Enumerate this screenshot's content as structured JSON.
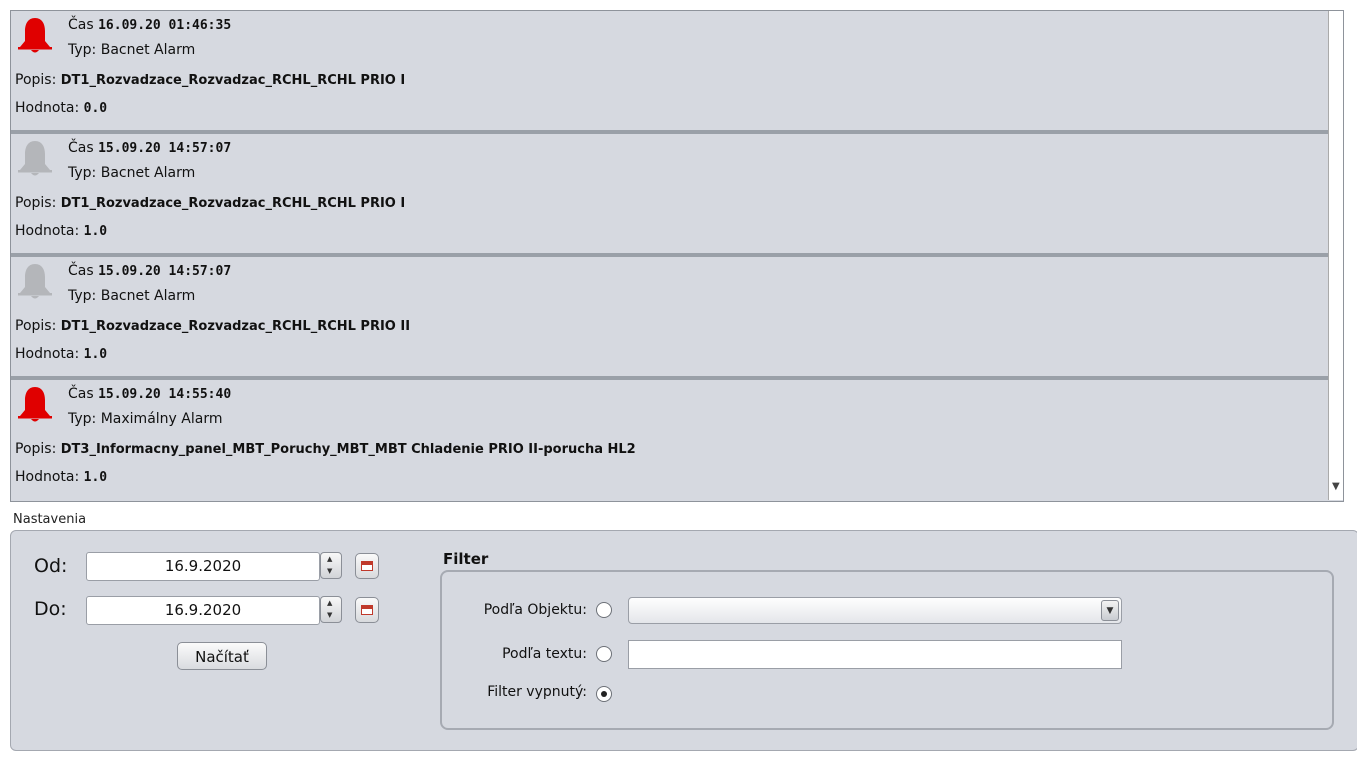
{
  "alarms": [
    {
      "active": true,
      "time_label": "Čas",
      "time": "16.09.20 01:46:35",
      "type_label": "Typ:",
      "type": "Bacnet Alarm",
      "desc_label": "Popis:",
      "desc": "DT1_Rozvadzace_Rozvadzac_RCHL_RCHL PRIO I",
      "value_label": "Hodnota:",
      "value": "0.0"
    },
    {
      "active": false,
      "time_label": "Čas",
      "time": "15.09.20 14:57:07",
      "type_label": "Typ:",
      "type": "Bacnet Alarm",
      "desc_label": "Popis:",
      "desc": "DT1_Rozvadzace_Rozvadzac_RCHL_RCHL PRIO I",
      "value_label": "Hodnota:",
      "value": "1.0"
    },
    {
      "active": false,
      "time_label": "Čas",
      "time": "15.09.20 14:57:07",
      "type_label": "Typ:",
      "type": "Bacnet Alarm",
      "desc_label": "Popis:",
      "desc": "DT1_Rozvadzace_Rozvadzac_RCHL_RCHL PRIO II",
      "value_label": "Hodnota:",
      "value": "1.0"
    },
    {
      "active": true,
      "time_label": "Čas",
      "time": "15.09.20 14:55:40",
      "type_label": "Typ:",
      "type": "Maximálny Alarm",
      "desc_label": "Popis:",
      "desc": "DT3_Informacny_panel_MBT_Poruchy_MBT_MBT Chladenie PRIO II-porucha HL2",
      "value_label": "Hodnota:",
      "value": "1.0"
    }
  ],
  "colors": {
    "bell_active": "#e00000",
    "bell_inactive": "#b4b6ba"
  },
  "settings": {
    "title": "Nastavenia",
    "from_label": "Od:",
    "from_value": "16.9.2020",
    "to_label": "Do:",
    "to_value": "16.9.2020",
    "load_button": "Načítať"
  },
  "filter": {
    "title": "Filter",
    "by_object_label": "Podľa Objektu:",
    "by_text_label": "Podľa textu:",
    "off_label": "Filter vypnutý:",
    "selected": "off"
  }
}
